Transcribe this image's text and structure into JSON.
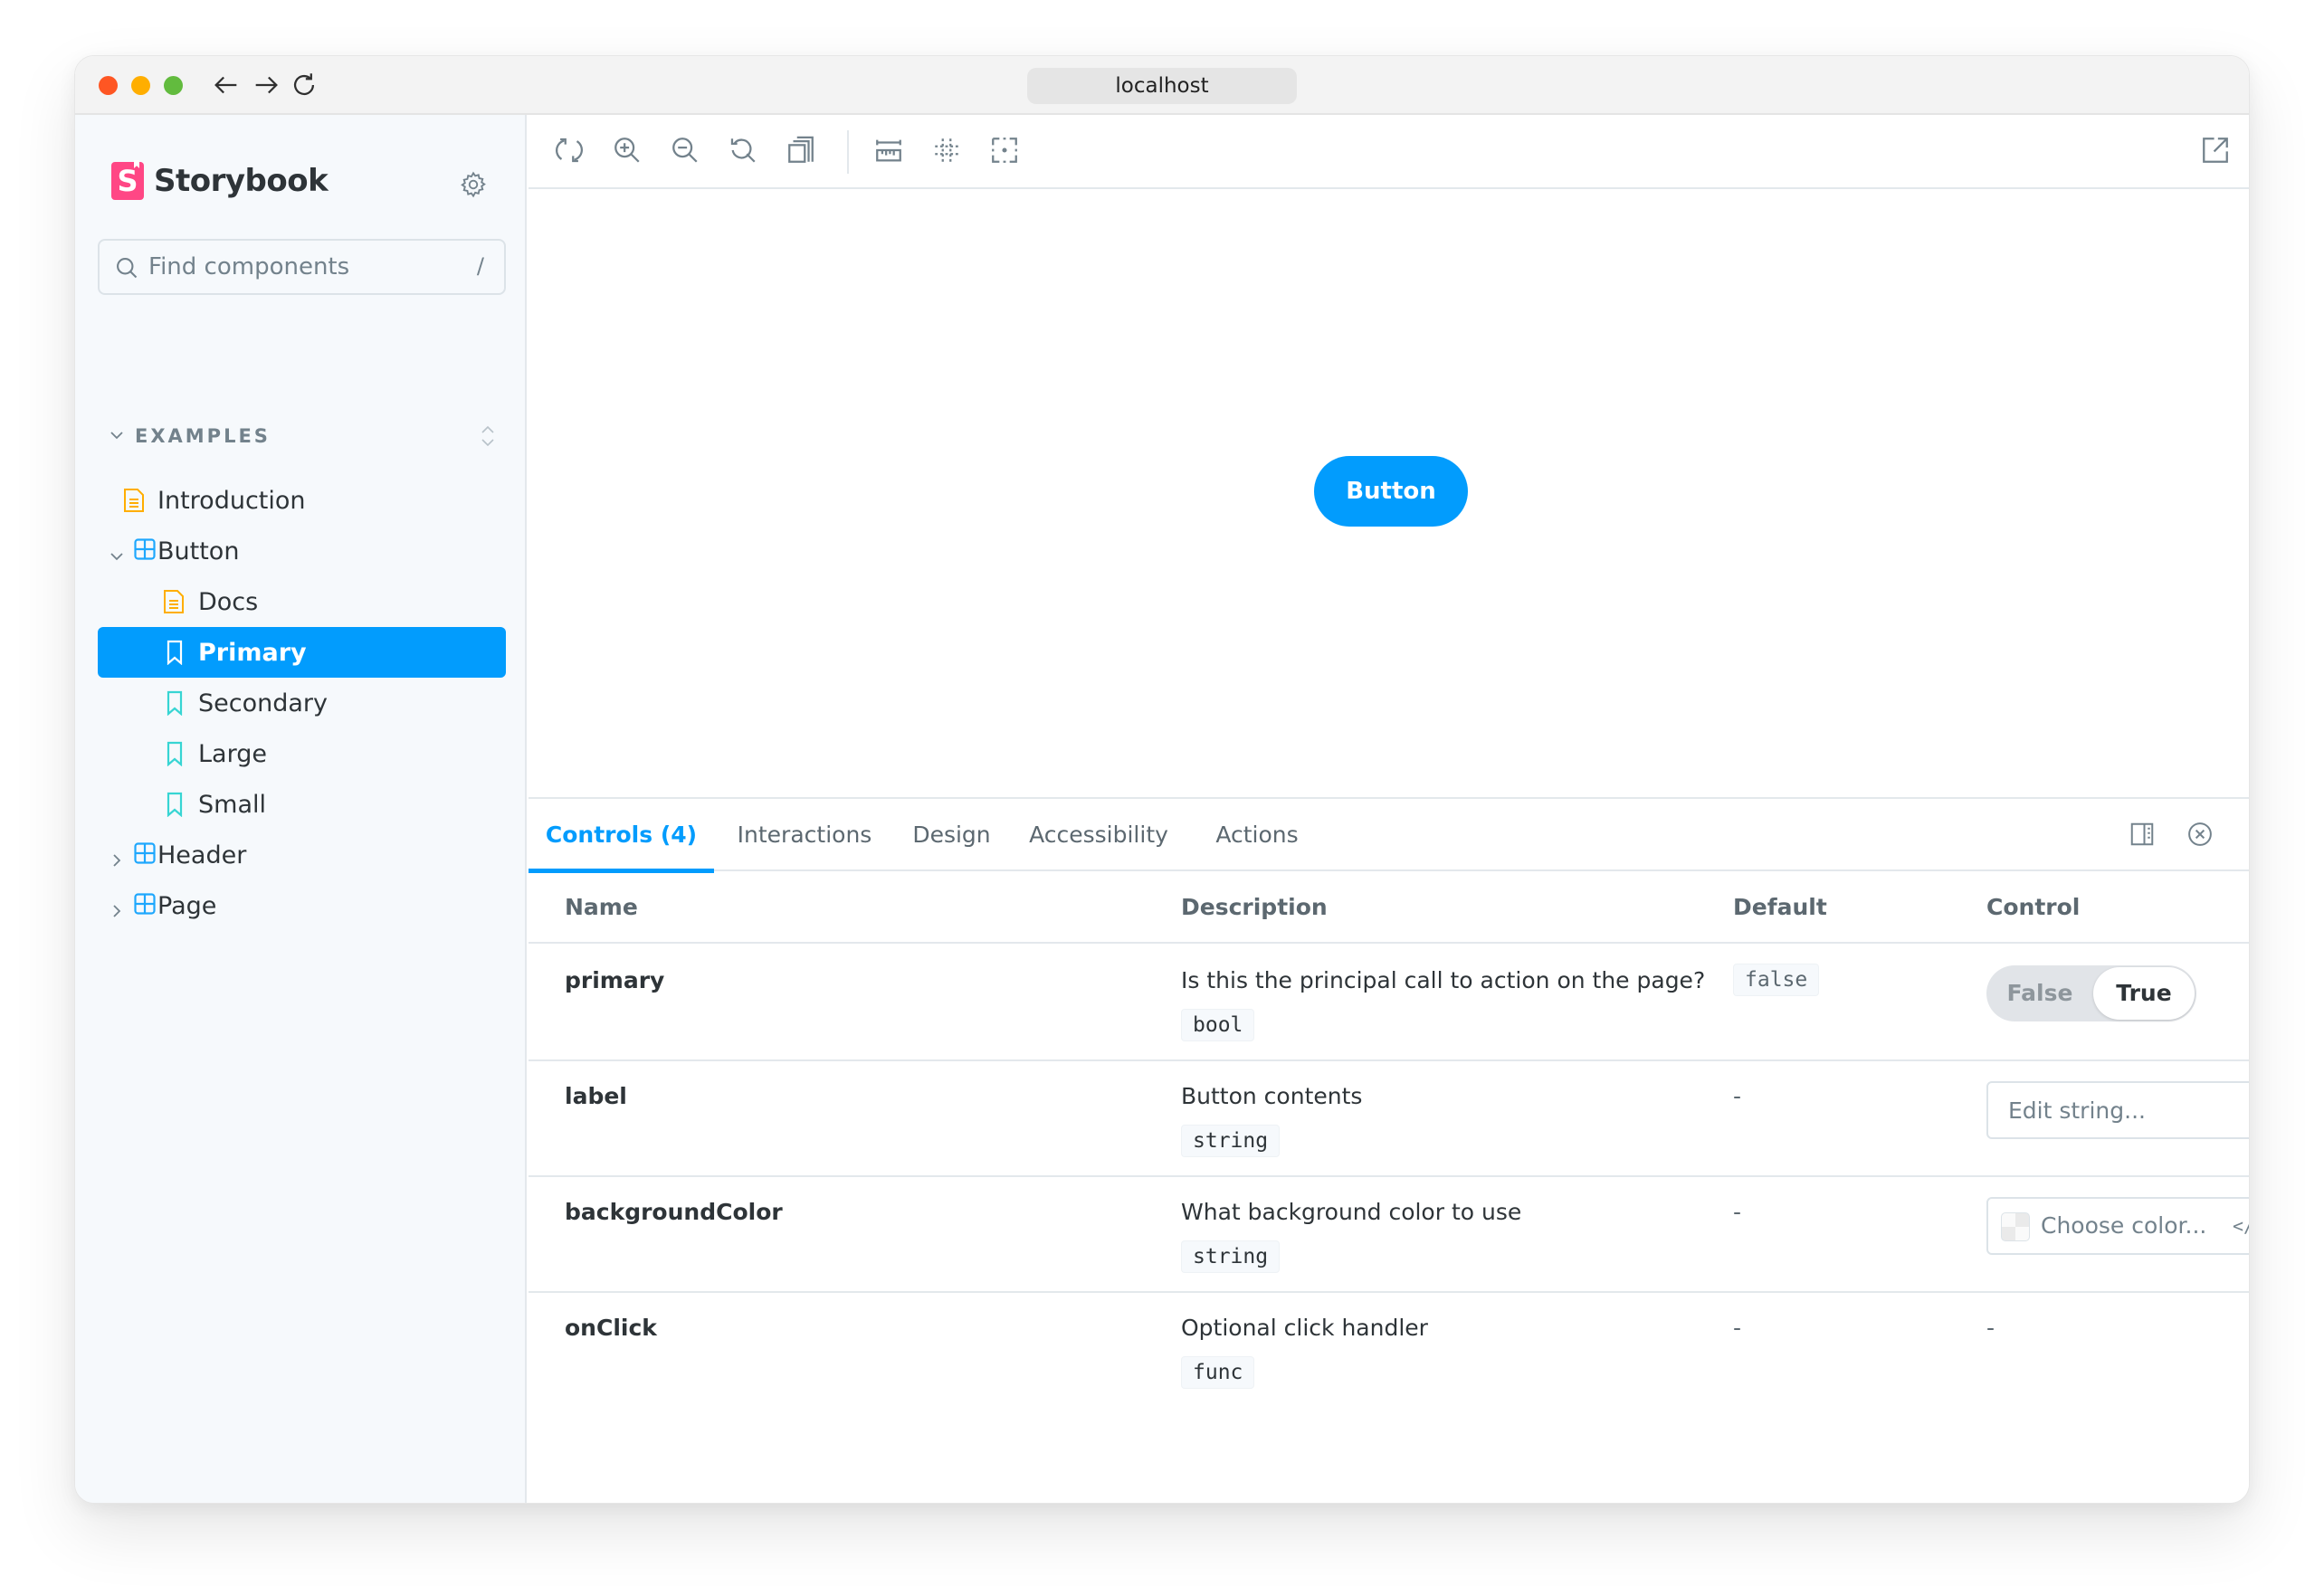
{
  "browser": {
    "url": "localhost",
    "traffic_lights": [
      "close",
      "minimize",
      "maximize"
    ],
    "nav": [
      "back-arrow-icon",
      "forward-arrow-icon",
      "reload-icon"
    ]
  },
  "sidebar": {
    "brand": "Storybook",
    "brand_mark": "S",
    "search": {
      "placeholder": "Find components",
      "shortcut": "/"
    },
    "section_title": "EXAMPLES",
    "items": [
      {
        "label": "Introduction",
        "icon": "document-icon",
        "level": 1
      },
      {
        "label": "Button",
        "icon": "component-icon",
        "level": 1,
        "expanded": true
      },
      {
        "label": "Docs",
        "icon": "document-icon",
        "level": 2
      },
      {
        "label": "Primary",
        "icon": "bookmark-icon",
        "level": 2,
        "selected": true
      },
      {
        "label": "Secondary",
        "icon": "bookmark-icon",
        "level": 2
      },
      {
        "label": "Large",
        "icon": "bookmark-icon",
        "level": 2
      },
      {
        "label": "Small",
        "icon": "bookmark-icon",
        "level": 2
      },
      {
        "label": "Header",
        "icon": "component-icon",
        "level": 1,
        "expanded": false
      },
      {
        "label": "Page",
        "icon": "component-icon",
        "level": 1,
        "expanded": false
      }
    ]
  },
  "toolbar": {
    "tools": [
      "remount-icon",
      "zoom-in-icon",
      "zoom-out-icon",
      "zoom-reset-icon",
      "background-icon",
      "measure-icon",
      "grid-icon",
      "outline-icon"
    ],
    "open_new_tab": "open-in-new-tab-icon"
  },
  "preview": {
    "button_label": "Button"
  },
  "addons": {
    "tabs": [
      {
        "label": "Controls (4)",
        "active": true
      },
      {
        "label": "Interactions"
      },
      {
        "label": "Design"
      },
      {
        "label": "Accessibility"
      },
      {
        "label": "Actions"
      }
    ],
    "table": {
      "headers": {
        "name": "Name",
        "description": "Description",
        "default": "Default",
        "control": "Control"
      },
      "rows": [
        {
          "name": "primary",
          "description": "Is this the principal call to action on the page?",
          "type": "bool",
          "default": "false",
          "control": {
            "kind": "boolean",
            "false_label": "False",
            "true_label": "True",
            "value": true
          }
        },
        {
          "name": "label",
          "description": "Button contents",
          "type": "string",
          "default": "-",
          "control": {
            "kind": "text",
            "placeholder": "Edit string..."
          }
        },
        {
          "name": "backgroundColor",
          "description": "What background color to use",
          "type": "string",
          "default": "-",
          "control": {
            "kind": "color",
            "placeholder": "Choose color...",
            "code_icon": "</>"
          }
        },
        {
          "name": "onClick",
          "description": "Optional click handler",
          "type": "func",
          "default": "-",
          "control": {
            "kind": "none",
            "text": "-"
          }
        }
      ]
    }
  },
  "colors": {
    "accent": "#029cfd",
    "brand": "#ff4785",
    "doc_icon": "#ffae00",
    "story_icon": "#37d5d3",
    "component_icon": "#1ea7fd"
  }
}
